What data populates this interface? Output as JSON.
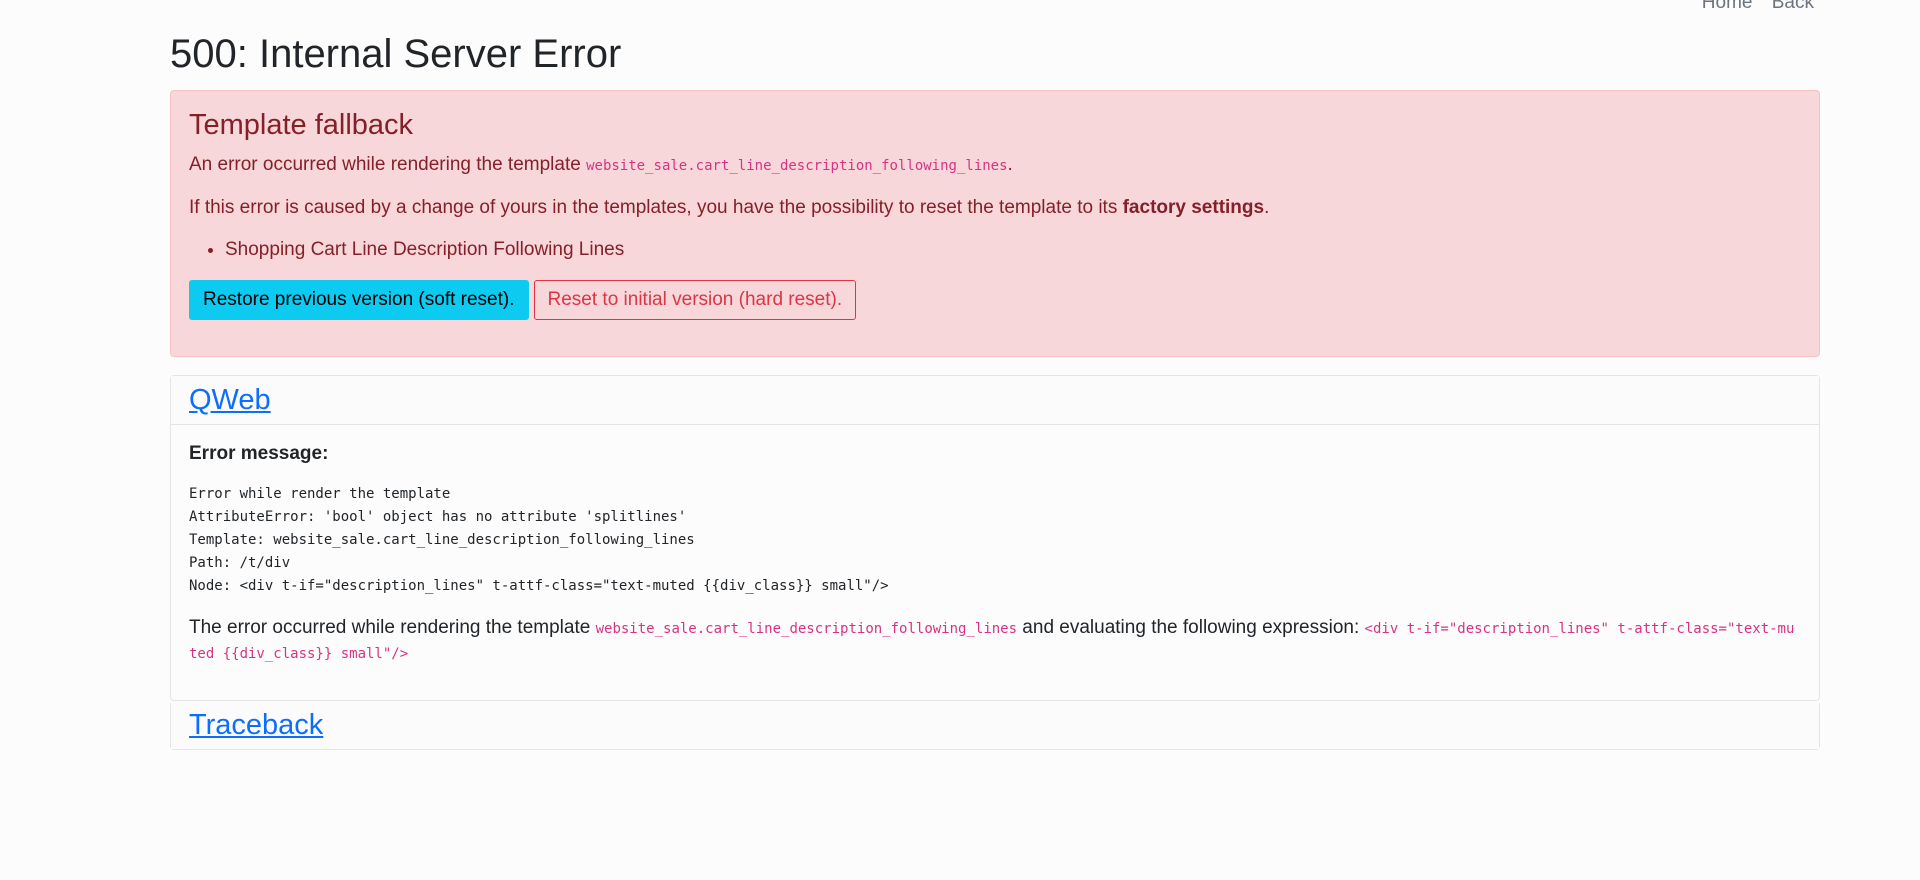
{
  "nav": {
    "home": "Home",
    "back": "Back"
  },
  "page": {
    "title": "500: Internal Server Error"
  },
  "alert": {
    "heading": "Template fallback",
    "line1_prefix": "An error occurred while rendering the template ",
    "line1_template": "website_sale.cart_line_description_following_lines",
    "line1_suffix": ".",
    "line2_prefix": "If this error is caused by a change of yours in the templates, you have the possibility to reset the template to its ",
    "line2_bold": "factory settings",
    "line2_suffix": ".",
    "items": [
      "Shopping Cart Line Description Following Lines"
    ],
    "soft_reset": "Restore previous version (soft reset).",
    "hard_reset": "Reset to initial version (hard reset)."
  },
  "qweb": {
    "link": "QWeb",
    "error_label": "Error message:",
    "error_text": "Error while render the template\nAttributeError: 'bool' object has no attribute 'splitlines'\nTemplate: website_sale.cart_line_description_following_lines\nPath: /t/div\nNode: <div t-if=\"description_lines\" t-attf-class=\"text-muted {{div_class}} small\"/>",
    "foot_prefix": "The error occurred while rendering the template ",
    "foot_template": "website_sale.cart_line_description_following_lines",
    "foot_middle": " and evaluating the following expression: ",
    "foot_expression": "<div t-if=\"description_lines\" t-attf-class=\"text-muted {{div_class}} small\"/>"
  },
  "traceback": {
    "link": "Traceback"
  },
  "colors": {
    "alert_bg": "#f8d7da",
    "alert_text": "#842029",
    "soft_button": "#0dcaf0",
    "hard_button": "#dc3545",
    "link": "#0d6efd",
    "code": "#d63384"
  }
}
